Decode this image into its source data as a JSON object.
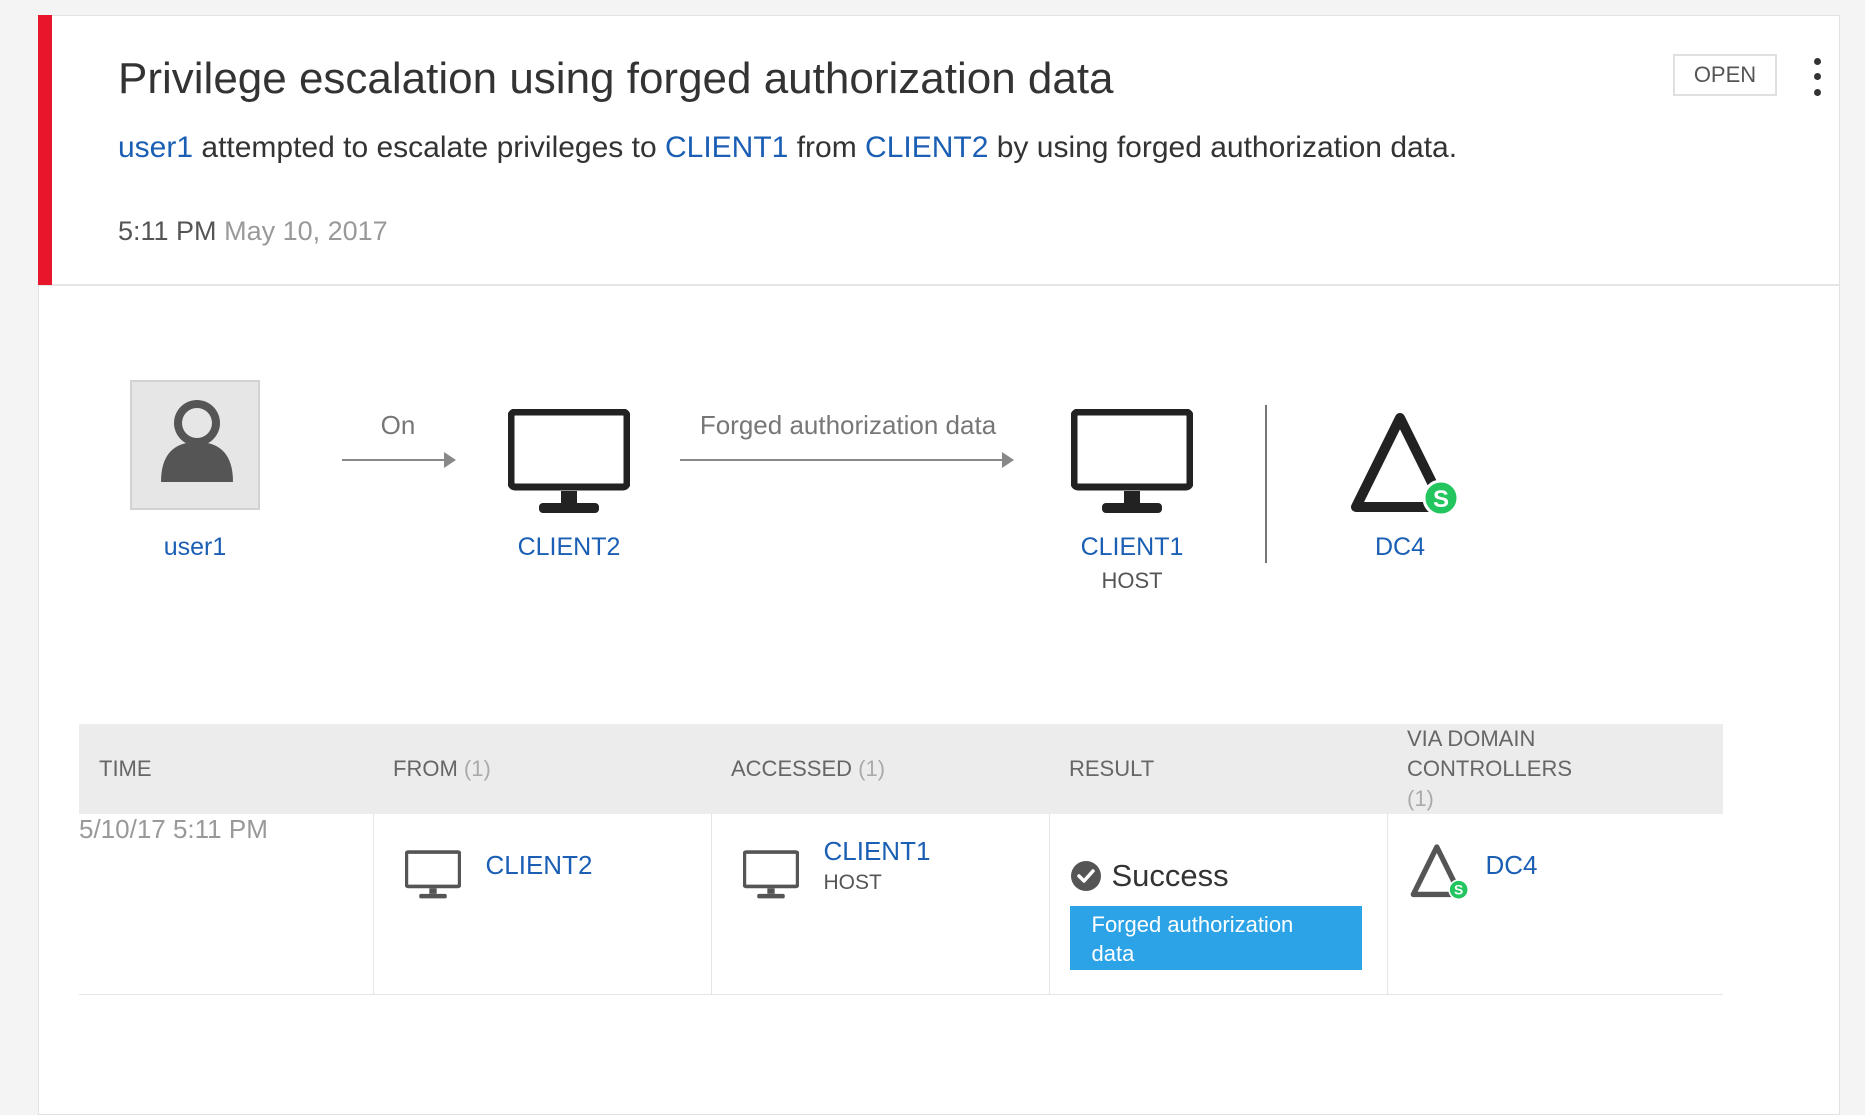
{
  "alert": {
    "title": "Privilege escalation using forged authorization data",
    "description": {
      "user": "user1",
      "text1": " attempted to escalate privileges to ",
      "target": "CLIENT1",
      "text2": " from ",
      "source": "CLIENT2",
      "text3": " by using forged authorization data."
    },
    "time": "5:11 PM",
    "date": "May 10, 2017",
    "status": "OPEN",
    "accent_color": "#e8162a"
  },
  "diagram": {
    "user": {
      "label": "user1",
      "icon": "user-avatar-icon"
    },
    "edge1_label": "On",
    "source": {
      "label": "CLIENT2",
      "icon": "monitor-icon"
    },
    "edge2_label": "Forged authorization data",
    "target": {
      "label": "CLIENT1",
      "sublabel": "HOST",
      "icon": "monitor-icon"
    },
    "dc": {
      "label": "DC4",
      "icon": "domain-controller-icon",
      "badge": "S"
    }
  },
  "table": {
    "headers": {
      "time": "TIME",
      "from": "FROM",
      "from_count": "(1)",
      "accessed": "ACCESSED",
      "accessed_count": "(1)",
      "result": "RESULT",
      "via": "VIA DOMAIN CONTROLLERS",
      "via_count": "(1)"
    },
    "rows": [
      {
        "time": "5/10/17 5:11 PM",
        "from": "CLIENT2",
        "accessed": "CLIENT1",
        "accessed_sub": "HOST",
        "result": "Success",
        "result_tag": "Forged authorization data",
        "via": "DC4",
        "via_badge": "S"
      }
    ]
  },
  "colors": {
    "link": "#1a5fb4",
    "badge_green": "#22c55e",
    "tag_blue": "#2ba3e6"
  }
}
